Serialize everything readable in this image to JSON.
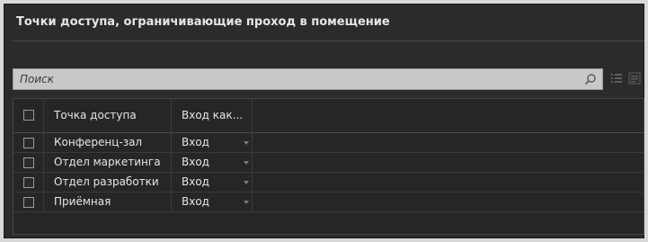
{
  "panel": {
    "title": "Точки доступа, ограничивающие проход в помещение"
  },
  "search": {
    "placeholder": "Поиск"
  },
  "toolbar": {
    "icons": [
      "search-icon",
      "list-view-icon",
      "detail-view-icon"
    ]
  },
  "table": {
    "columns": [
      "Точка доступа",
      "Вход как..."
    ],
    "rows": [
      {
        "name": "Конференц-зал",
        "mode": "Вход"
      },
      {
        "name": "Отдел маркетинга",
        "mode": "Вход"
      },
      {
        "name": "Отдел разработки",
        "mode": "Вход"
      },
      {
        "name": "Приёмная",
        "mode": "Вход"
      }
    ]
  }
}
